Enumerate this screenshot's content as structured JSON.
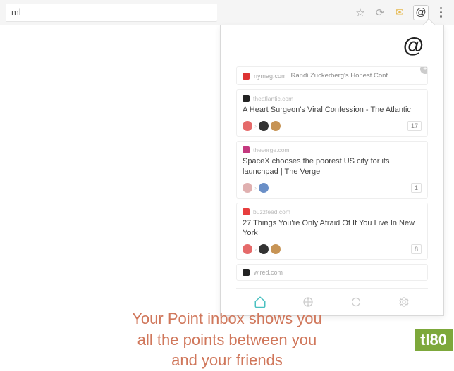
{
  "browser": {
    "url_fragment": "ml"
  },
  "popup": {
    "logo": "@"
  },
  "cards": [
    {
      "domain": "nymag.com",
      "title_short": "Randi Zuckerberg's Honest Conf…"
    },
    {
      "domain": "theatlantic.com",
      "title": "A Heart Surgeon's Viral Confession - The Atlantic",
      "count": "17"
    },
    {
      "domain": "theverge.com",
      "title": "SpaceX chooses the poorest US city for its launchpad | The Verge",
      "count": "1"
    },
    {
      "domain": "buzzfeed.com",
      "title": "27 Things You're Only Afraid Of If You Live In New York",
      "count": "8"
    },
    {
      "domain": "wired.com"
    }
  ],
  "caption": {
    "line1": "Your Point inbox shows you",
    "line2": "all the points between you",
    "line3": "and your friends"
  },
  "watermark": "tl80"
}
